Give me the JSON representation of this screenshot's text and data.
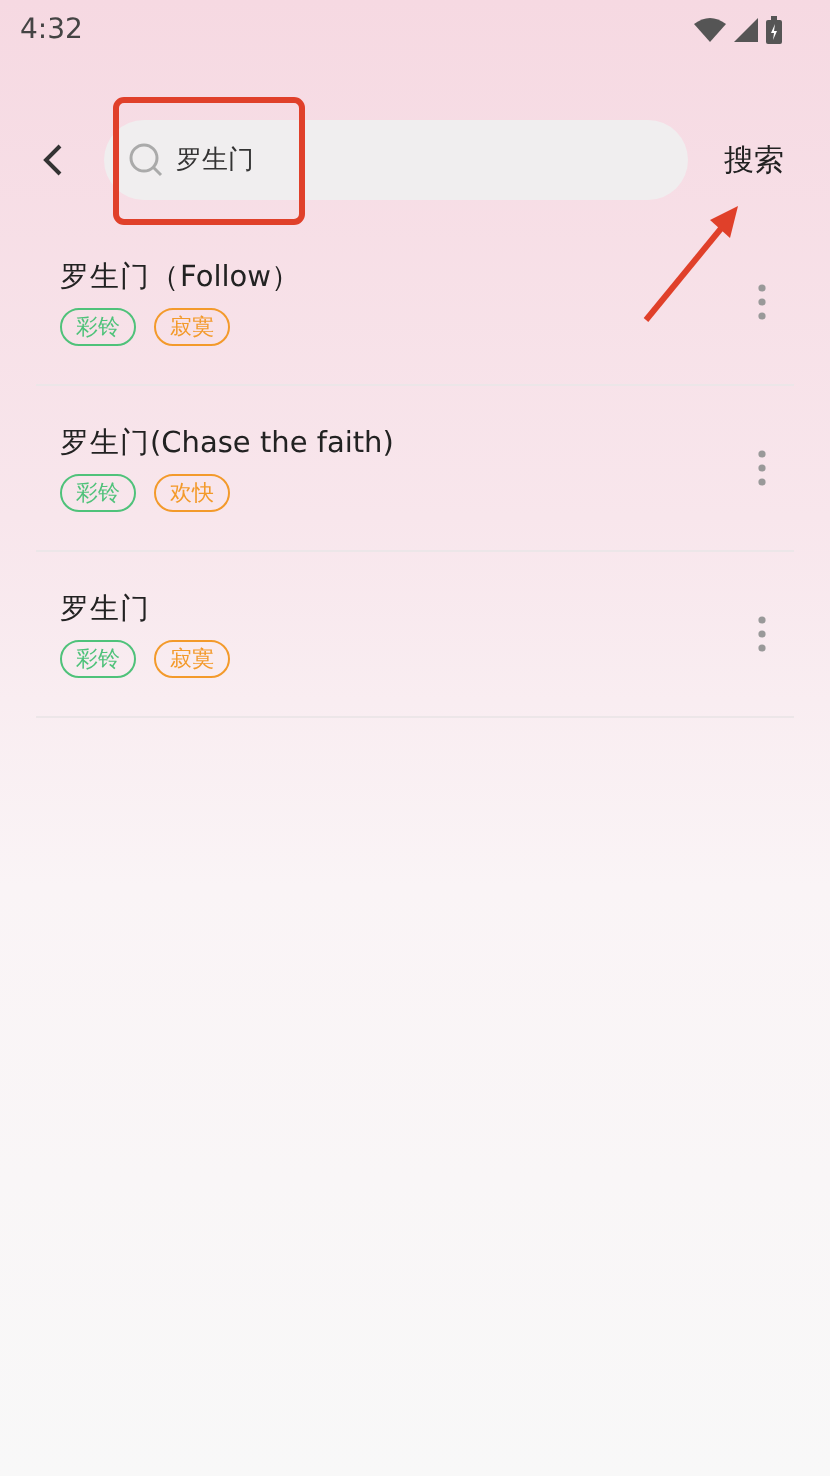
{
  "status_bar": {
    "time": "4:32"
  },
  "search": {
    "value": "罗生门",
    "button": "搜索"
  },
  "results": [
    {
      "title": "罗生门（Follow）",
      "tags": [
        {
          "label": "彩铃",
          "color": "#4fc27a"
        },
        {
          "label": "寂寞",
          "color": "#f39a2b"
        }
      ]
    },
    {
      "title": "罗生门(Chase the faith)",
      "tags": [
        {
          "label": "彩铃",
          "color": "#4fc27a"
        },
        {
          "label": "欢快",
          "color": "#f39a2b"
        }
      ]
    },
    {
      "title": "罗生门",
      "tags": [
        {
          "label": "彩铃",
          "color": "#4fc27a"
        },
        {
          "label": "寂寞",
          "color": "#f39a2b"
        }
      ]
    }
  ]
}
